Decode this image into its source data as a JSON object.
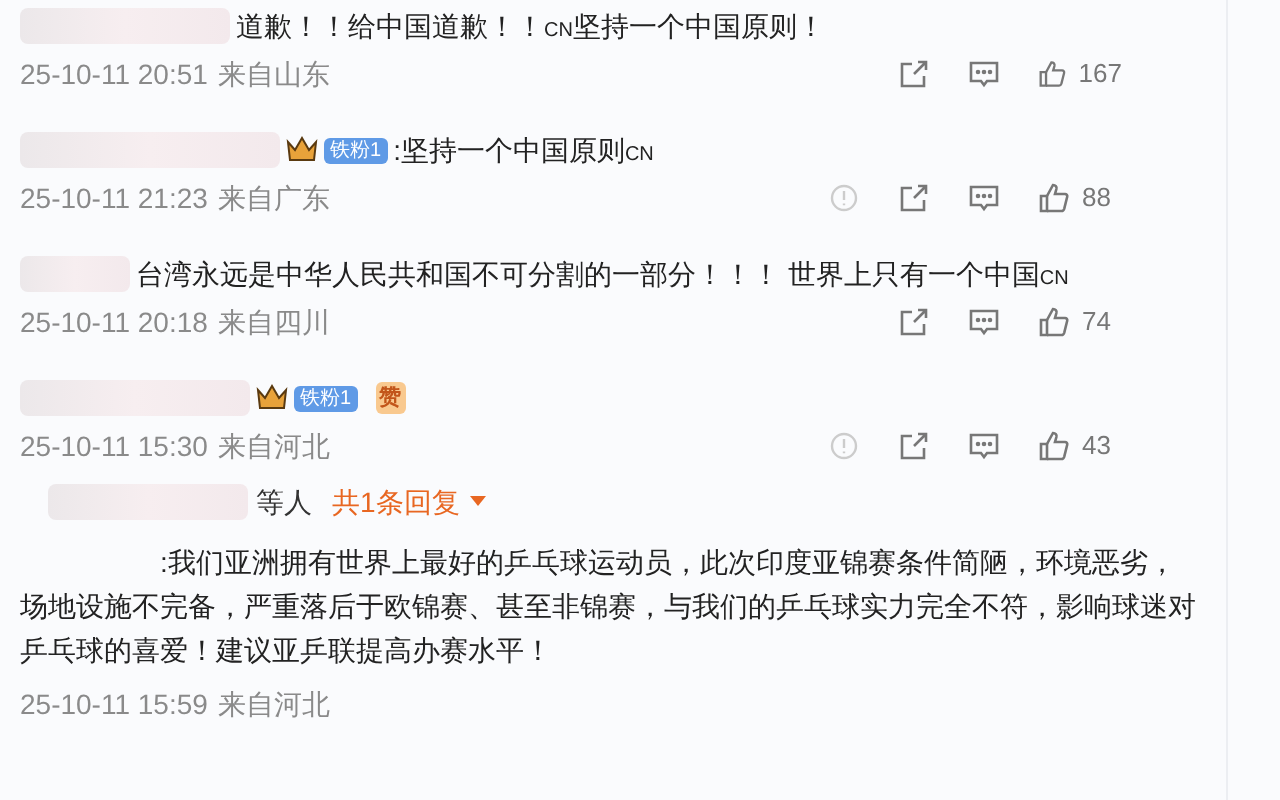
{
  "comments": [
    {
      "crown": false,
      "segments": [
        {
          "kind": "plain",
          "text": "道歉！！给中国道歉！！"
        },
        {
          "kind": "cn",
          "text": "CN"
        },
        {
          "kind": "plain",
          "text": "坚持一个中国原则！"
        }
      ],
      "time": "25-10-11 20:51",
      "location": "来自山东",
      "report": false,
      "likes": "167"
    },
    {
      "crown": true,
      "badge": "铁粉1",
      "segments": [
        {
          "kind": "plain",
          "text": ":坚持一个中国原则"
        },
        {
          "kind": "cn",
          "text": "CN"
        }
      ],
      "time": "25-10-11 21:23",
      "location": "来自广东",
      "report": true,
      "likes": "88"
    },
    {
      "crown": false,
      "segments": [
        {
          "kind": "plain",
          "text": "台湾永远是中华人民共和国不可分割的一部分！！！ 世界上只有一个中国"
        },
        {
          "kind": "cn",
          "text": "CN"
        }
      ],
      "time": "25-10-11 20:18",
      "location": "来自四川",
      "report": false,
      "likes": "74"
    },
    {
      "crown": true,
      "badge": "铁粉1",
      "emoji": "赞",
      "time": "25-10-11 15:30",
      "location": "来自河北",
      "report": true,
      "likes": "43"
    }
  ],
  "reply_summary": {
    "others": "等人",
    "count": "共1条回复"
  },
  "last_comment": {
    "text": ":我们亚洲拥有世界上最好的乒乓球运动员，此次印度亚锦赛条件简陋，环境恶劣，场地设施不完备，严重落后于欧锦赛、甚至非锦赛，与我们的乒乓球实力完全不符，影响球迷对乒乓球的喜爱！建议亚乒联提高办赛水平！",
    "time": "25-10-11 15:59",
    "location": "来自河北"
  }
}
